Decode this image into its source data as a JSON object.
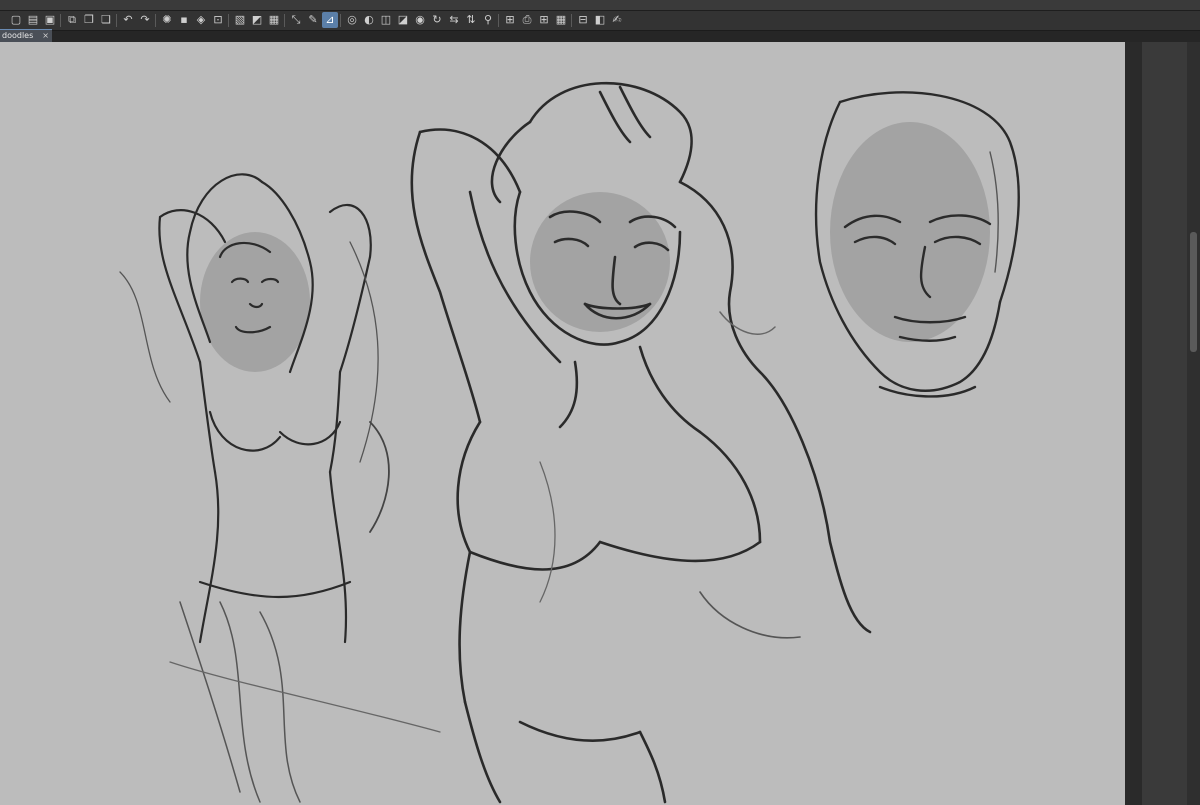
{
  "toolbar": {
    "buttons": [
      {
        "name": "new-file-icon",
        "glyph": "▢"
      },
      {
        "name": "open-file-icon",
        "glyph": "▤"
      },
      {
        "name": "save-icon",
        "glyph": "▣"
      },
      {
        "name": "copy-canvas-icon",
        "glyph": "⧉"
      },
      {
        "name": "layers-icon",
        "glyph": "❐"
      },
      {
        "name": "duplicate-icon",
        "glyph": "❏"
      },
      {
        "name": "undo-icon",
        "glyph": "↶"
      },
      {
        "name": "redo-icon",
        "glyph": "↷"
      },
      {
        "name": "loading-icon",
        "glyph": "✺"
      },
      {
        "name": "clear-icon",
        "glyph": "▪"
      },
      {
        "name": "fill-icon",
        "glyph": "◈"
      },
      {
        "name": "crop-icon",
        "glyph": "⊡"
      },
      {
        "name": "selection-off-icon",
        "glyph": "▧"
      },
      {
        "name": "invert-selection-icon",
        "glyph": "◩"
      },
      {
        "name": "selection-border-icon",
        "glyph": "▦"
      },
      {
        "name": "transform-icon",
        "glyph": "⤡"
      },
      {
        "name": "pen-icon",
        "glyph": "✎"
      },
      {
        "name": "ruler-icon",
        "glyph": "⊿"
      },
      {
        "name": "snap-icon",
        "glyph": "◎"
      },
      {
        "name": "balloon-icon",
        "glyph": "◐"
      },
      {
        "name": "frame-icon",
        "glyph": "◫"
      },
      {
        "name": "frame-alt-icon",
        "glyph": "◪"
      },
      {
        "name": "view-icon",
        "glyph": "◉"
      },
      {
        "name": "rotate-icon",
        "glyph": "↻"
      },
      {
        "name": "flip-horizontal-icon",
        "glyph": "⇆"
      },
      {
        "name": "flip-vertical-icon",
        "glyph": "⇅"
      },
      {
        "name": "zoom-icon",
        "glyph": "⚲"
      },
      {
        "name": "fit-icon",
        "glyph": "⊞"
      },
      {
        "name": "print-icon",
        "glyph": "⎙"
      },
      {
        "name": "grid-icon",
        "glyph": "⊞"
      },
      {
        "name": "pattern-icon",
        "glyph": "▦"
      },
      {
        "name": "panel-icon",
        "glyph": "⊟"
      },
      {
        "name": "layout-icon",
        "glyph": "◧"
      },
      {
        "name": "edit-icon",
        "glyph": "✍"
      }
    ]
  },
  "tab": {
    "label": "doodles",
    "close": "×"
  },
  "side_menu_glyph": "☰"
}
